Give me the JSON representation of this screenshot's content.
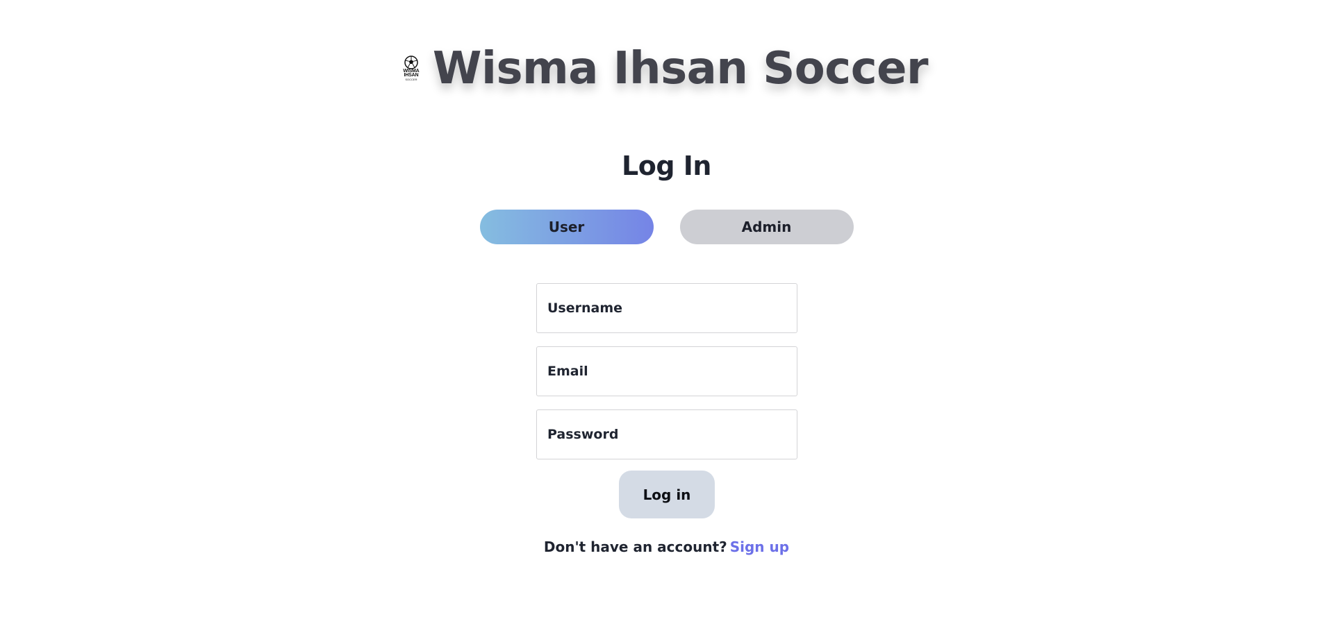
{
  "brand": {
    "title": "Wisma Ihsan Soccer",
    "logo_line1": "WISMA",
    "logo_line2": "IHSAN",
    "logo_line3": "SOCCER",
    "logo_icon": "soccer-ball-icon"
  },
  "login": {
    "heading": "Log In",
    "roles": [
      {
        "label": "User",
        "active": true
      },
      {
        "label": "Admin",
        "active": false
      }
    ],
    "fields": {
      "username": {
        "placeholder": "Username",
        "value": ""
      },
      "email": {
        "placeholder": "Email",
        "value": ""
      },
      "password": {
        "placeholder": "Password",
        "value": ""
      }
    },
    "submit_label": "Log in",
    "signup_prompt": "Don't have an account?",
    "signup_link": "Sign up"
  },
  "colors": {
    "title": "#43444d",
    "user_gradient_start": "#85bde0",
    "user_gradient_end": "#7584e6",
    "admin_bg": "#cdced3",
    "submit_bg": "#d4dbe5",
    "link": "#6c70e8"
  }
}
